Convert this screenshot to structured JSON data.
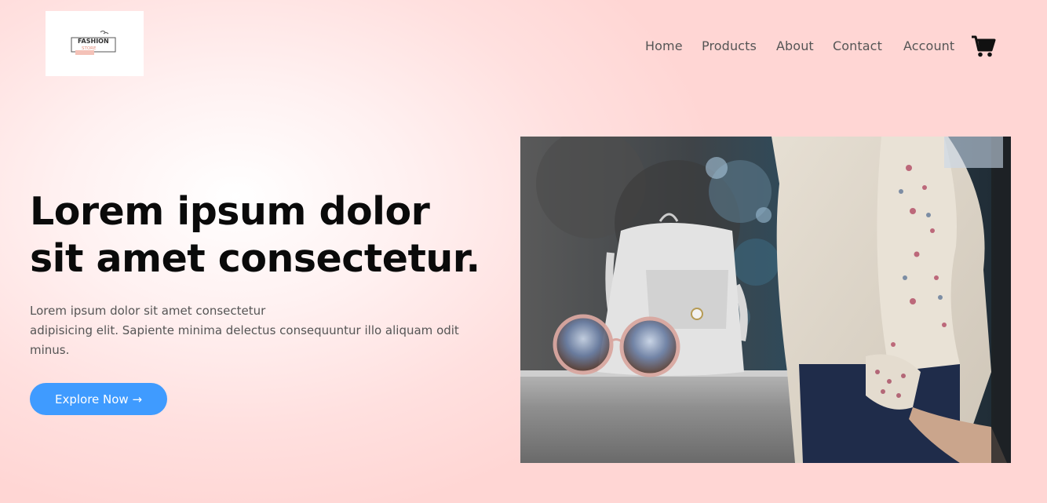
{
  "logo": {
    "line1": "FASHION",
    "line2": "STORE"
  },
  "nav": {
    "items": [
      {
        "label": "Home"
      },
      {
        "label": "Products"
      },
      {
        "label": "About"
      },
      {
        "label": "Contact"
      },
      {
        "label": "Account"
      }
    ],
    "cart_icon": "shopping-cart-icon"
  },
  "hero": {
    "title_line1": "Lorem ipsum dolor",
    "title_line2": "sit amet consectetur.",
    "text_line1": "Lorem ipsum dolor sit amet consectetur",
    "text_line2": "adipisicing elit. Sapiente minima delectus consequuntur illo aliquam odit minus.",
    "button_label": "Explore Now →"
  },
  "colors": {
    "accent": "#3f9bff",
    "background": "#ffe0df",
    "heading": "#0a0a0a",
    "body_text": "#555555"
  }
}
